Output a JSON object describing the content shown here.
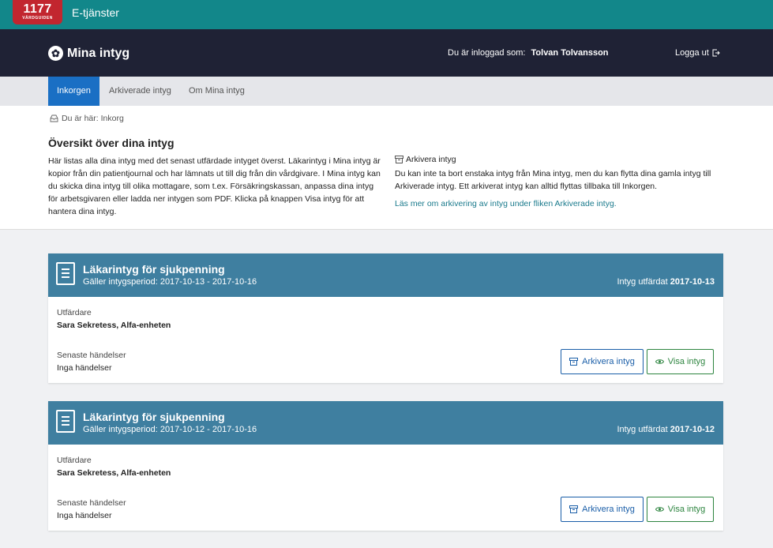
{
  "topbar": {
    "logo_number": "1177",
    "logo_sub": "VÅRDGUIDEN",
    "title": "E-tjänster"
  },
  "header": {
    "brand": "Mina intyg",
    "logged_in_label": "Du är inloggad som:",
    "user_name": "Tolvan Tolvansson",
    "logout": "Logga ut"
  },
  "tabs": [
    {
      "label": "Inkorgen",
      "active": true
    },
    {
      "label": "Arkiverade intyg",
      "active": false
    },
    {
      "label": "Om Mina intyg",
      "active": false
    }
  ],
  "breadcrumb": "Du är här: Inkorg",
  "intro": {
    "title": "Översikt över dina intyg",
    "text": "Här listas alla dina intyg med det senast utfärdade intyget överst. Läkarintyg i Mina intyg är kopior från din patientjournal och har lämnats ut till dig från din vårdgivare. I Mina intyg kan du skicka dina intyg till olika mottagare, som t.ex. Försäkringskassan, anpassa dina intyg för arbetsgivaren eller ladda ner intygen som PDF. Klicka på knappen Visa intyg för att hantera dina intyg.",
    "archive_title": "Arkivera intyg",
    "archive_text": "Du kan inte ta bort enstaka intyg från Mina intyg, men du kan flytta dina gamla intyg till Arkiverade intyg. Ett arkiverat intyg kan alltid flyttas tillbaka till Inkorgen.",
    "archive_link": "Läs mer om arkivering av intyg under fliken Arkiverade intyg."
  },
  "cards": [
    {
      "title": "Läkarintyg för sjukpenning",
      "period": "Gäller intygsperiod: 2017-10-13 - 2017-10-16",
      "issued_label": "Intyg utfärdat",
      "issued_date": "2017-10-13",
      "issuer_label": "Utfärdare",
      "issuer": "Sara Sekretess, Alfa-enheten",
      "events_label": "Senaste händelser",
      "events": "Inga händelser",
      "archive_button": "Arkivera intyg",
      "show_button": "Visa intyg"
    },
    {
      "title": "Läkarintyg för sjukpenning",
      "period": "Gäller intygsperiod: 2017-10-12 - 2017-10-16",
      "issued_label": "Intyg utfärdat",
      "issued_date": "2017-10-12",
      "issuer_label": "Utfärdare",
      "issuer": "Sara Sekretess, Alfa-enheten",
      "events_label": "Senaste händelser",
      "events": "Inga händelser",
      "archive_button": "Arkivera intyg",
      "show_button": "Visa intyg"
    }
  ],
  "colors": {
    "topbar": "#12878a",
    "header": "#1f2235",
    "active_tab": "#1a6fc4",
    "card_header": "#3f7fa0",
    "archive_button": "#1a5ea8",
    "show_button": "#2e8540",
    "link": "#1a7a8c"
  },
  "icons": {
    "brand": "accessibility-person-icon",
    "logout": "logout-icon",
    "breadcrumb": "inbox-icon",
    "archive": "archive-box-icon",
    "show": "eye-icon",
    "document": "document-icon"
  }
}
